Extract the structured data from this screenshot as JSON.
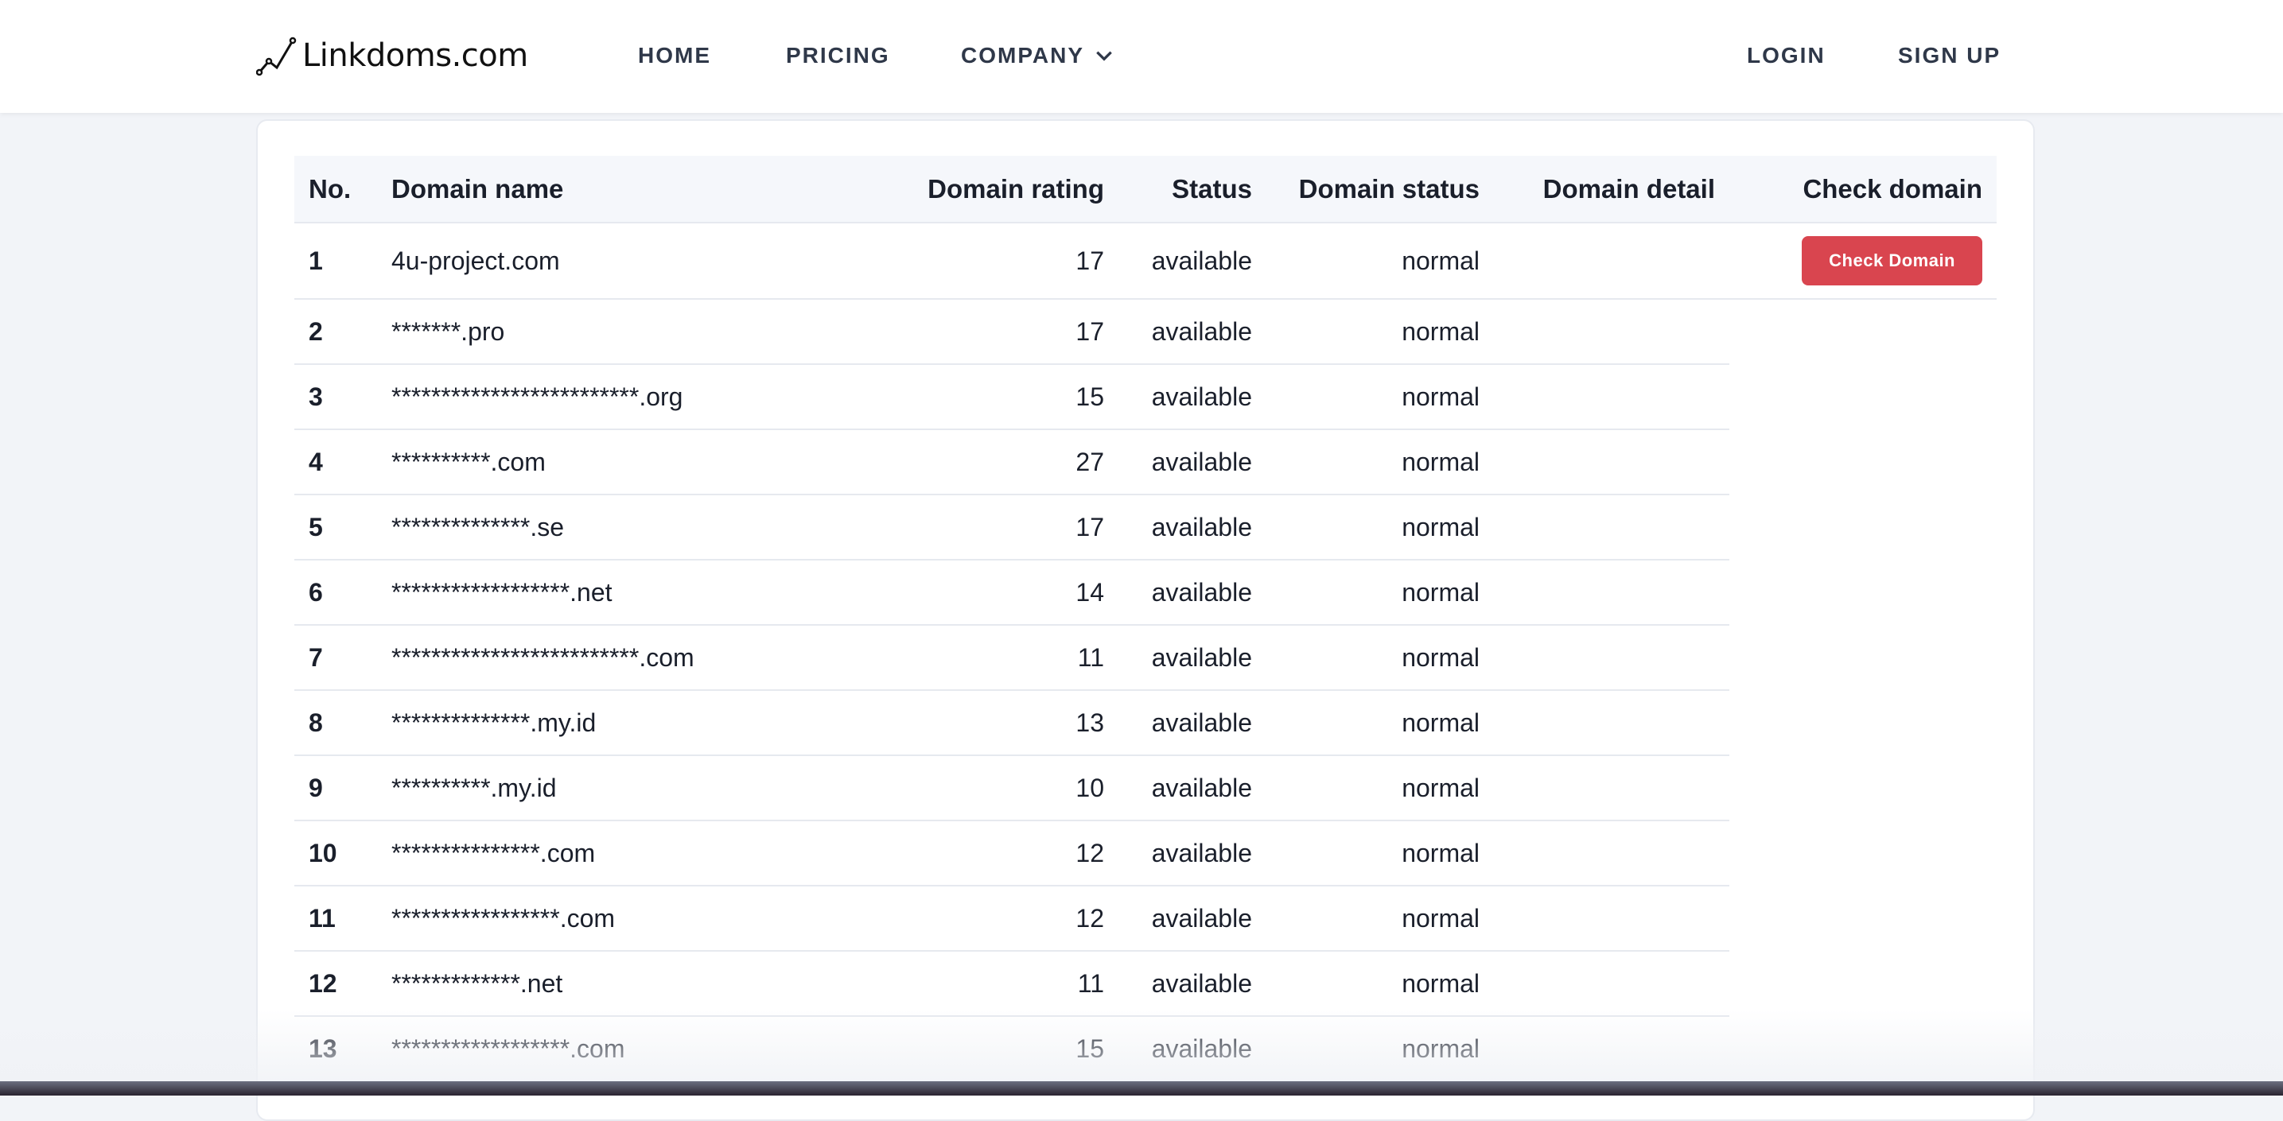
{
  "header": {
    "logo_text": "Linkdoms.com",
    "nav": {
      "home": "HOME",
      "pricing": "PRICING",
      "company": "COMPANY",
      "login": "LOGIN",
      "signup": "SIGN UP"
    }
  },
  "table": {
    "columns": {
      "no": "No.",
      "domain_name": "Domain name",
      "domain_rating": "Domain rating",
      "status": "Status",
      "domain_status": "Domain status",
      "domain_detail": "Domain detail",
      "check_domain": "Check domain"
    },
    "check_button_label": "Check Domain",
    "rows": [
      {
        "no": "1",
        "domain": "4u-project.com",
        "rating": "17",
        "status": "available",
        "domain_status": "normal"
      },
      {
        "no": "2",
        "domain": "*******.pro",
        "rating": "17",
        "status": "available",
        "domain_status": "normal"
      },
      {
        "no": "3",
        "domain": "*************************.org",
        "rating": "15",
        "status": "available",
        "domain_status": "normal"
      },
      {
        "no": "4",
        "domain": "**********.com",
        "rating": "27",
        "status": "available",
        "domain_status": "normal"
      },
      {
        "no": "5",
        "domain": "**************.se",
        "rating": "17",
        "status": "available",
        "domain_status": "normal"
      },
      {
        "no": "6",
        "domain": "******************.net",
        "rating": "14",
        "status": "available",
        "domain_status": "normal"
      },
      {
        "no": "7",
        "domain": "*************************.com",
        "rating": "11",
        "status": "available",
        "domain_status": "normal"
      },
      {
        "no": "8",
        "domain": "**************.my.id",
        "rating": "13",
        "status": "available",
        "domain_status": "normal"
      },
      {
        "no": "9",
        "domain": "**********.my.id",
        "rating": "10",
        "status": "available",
        "domain_status": "normal"
      },
      {
        "no": "10",
        "domain": "***************.com",
        "rating": "12",
        "status": "available",
        "domain_status": "normal"
      },
      {
        "no": "11",
        "domain": "*****************.com",
        "rating": "12",
        "status": "available",
        "domain_status": "normal"
      },
      {
        "no": "12",
        "domain": "*************.net",
        "rating": "11",
        "status": "available",
        "domain_status": "normal"
      },
      {
        "no": "13",
        "domain": "******************.com",
        "rating": "15",
        "status": "available",
        "domain_status": "normal"
      }
    ]
  },
  "colors": {
    "accent_button": "#d9454f",
    "page_background": "#f2f4f8",
    "header_background": "#ffffff"
  }
}
